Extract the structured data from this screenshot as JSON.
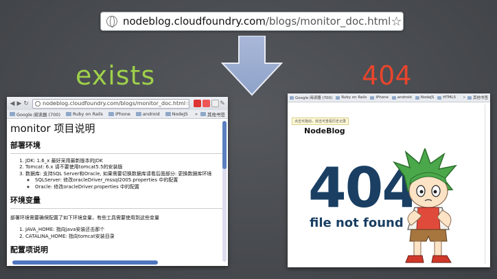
{
  "top_url": {
    "host": "nodeblog.cloudfoundry.com",
    "path": "/blogs/monitor_doc.html"
  },
  "labels": {
    "exists": "exists",
    "notfound": "404"
  },
  "left_browser": {
    "url": "nodeblog.cloudfoundry.com/blogs/monitor_doc.html",
    "bookmarks": [
      "Google 阅读器 (700)",
      "Ruby on Rails",
      "iPhone",
      "android",
      "NodeJS"
    ],
    "bookmarks_more": "»",
    "other_bookmarks": "其他书签",
    "page": {
      "title": "monitor 项目说明",
      "section1": "部署环境",
      "list1": [
        "JDK: 1.6_x 最好采用最新版本的JDK",
        "Tomcat: 6.x 请不要使用tomcat5.5的安装版",
        "数据库: 支持SQL Server和Oracle, 如果需要切换数据库请看后面部分: 更换数据库环境"
      ],
      "sublist": [
        "SQLServer: 修改oracleDriver_mssql2005.properties 中的配置",
        "Oracle: 修改oracleDriver.properties 中的配置"
      ],
      "section2": "环境变量",
      "para": "部署环境需要确保配置了如下环境变量，有些工具需要使用到这些变量",
      "list2": [
        "JAVA_HOME: 指向java安装还击那个",
        "CATALINA_HOME: 指向tomcat安装目录"
      ],
      "section3": "配置项说明"
    }
  },
  "right_browser": {
    "bookmarks": [
      "Google 阅读器 (700)",
      "Ruby on Rails",
      "iPhone",
      "android",
      "NodeJS",
      "HTML5"
    ],
    "bookmarks_more": "»",
    "other_bookmarks": "其他书签",
    "tooltip": "点击可拖动，双击可查看历史记录",
    "site_title": "NodeBlog",
    "big_code": "404",
    "message": "file not found"
  }
}
